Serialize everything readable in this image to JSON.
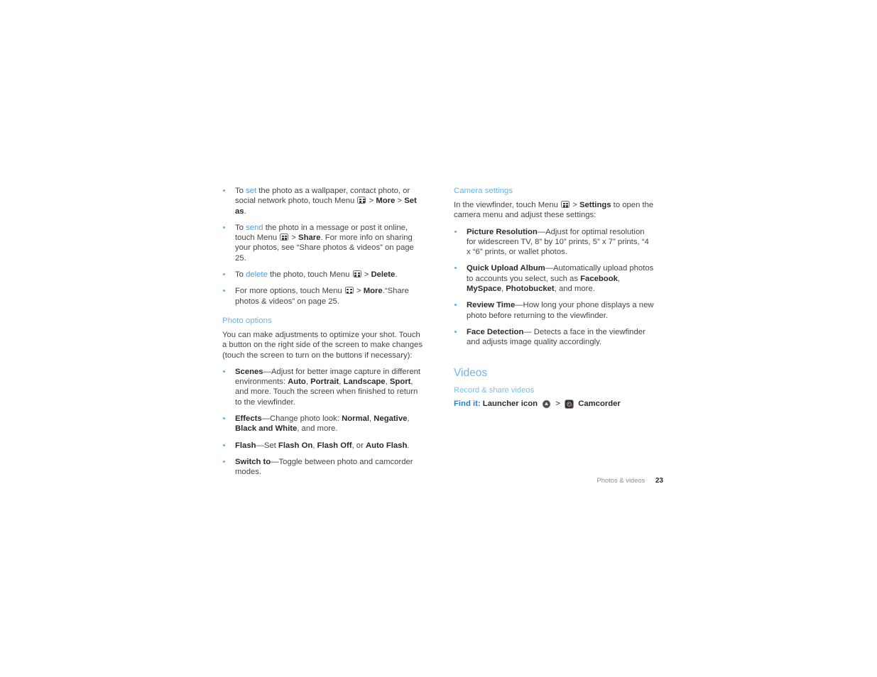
{
  "colors": {
    "heading_blue": "#69b3e7",
    "link_blue": "#4d9de0",
    "findit_blue": "#2a7fc9",
    "body_text": "#444444",
    "bold_text": "#2b2b2b",
    "footer_gray": "#8d8d8d",
    "bullet": "#6aa9e0"
  },
  "icons": {
    "menu_key": "menu-key-icon",
    "launcher": "launcher-icon",
    "camcorder": "camcorder-icon"
  },
  "left_column": {
    "photo_bullets": [
      {
        "parts": [
          {
            "t": "To ",
            "s": "n"
          },
          {
            "t": "set",
            "s": "link"
          },
          {
            "t": " the photo as a wallpaper, contact photo, or social network photo, touch Menu ",
            "s": "n"
          },
          {
            "t": "",
            "s": "menuicon"
          },
          {
            "t": " > ",
            "s": "n"
          },
          {
            "t": "More",
            "s": "b"
          },
          {
            "t": " > ",
            "s": "n"
          },
          {
            "t": "Set as",
            "s": "b"
          },
          {
            "t": ".",
            "s": "n"
          }
        ]
      },
      {
        "parts": [
          {
            "t": "To ",
            "s": "n"
          },
          {
            "t": "send",
            "s": "link"
          },
          {
            "t": " the photo in a message or post it online, touch Menu ",
            "s": "n"
          },
          {
            "t": "",
            "s": "menuicon"
          },
          {
            "t": " > ",
            "s": "n"
          },
          {
            "t": "Share",
            "s": "b"
          },
          {
            "t": ". For more info on sharing your photos, see “Share photos & videos” on page 25.",
            "s": "n"
          }
        ]
      },
      {
        "parts": [
          {
            "t": "To ",
            "s": "n"
          },
          {
            "t": "delete",
            "s": "link"
          },
          {
            "t": " the photo, touch Menu ",
            "s": "n"
          },
          {
            "t": "",
            "s": "menuicon"
          },
          {
            "t": " > ",
            "s": "n"
          },
          {
            "t": "Delete",
            "s": "b"
          },
          {
            "t": ".",
            "s": "n"
          }
        ]
      },
      {
        "parts": [
          {
            "t": "For more options, touch Menu ",
            "s": "n"
          },
          {
            "t": "",
            "s": "menuicon"
          },
          {
            "t": " > ",
            "s": "n"
          },
          {
            "t": "More",
            "s": "b"
          },
          {
            "t": ".“Share photos & videos” on page 25.",
            "s": "n"
          }
        ]
      }
    ],
    "photo_options_heading": "Photo options",
    "photo_options_intro": "You can make adjustments to optimize your shot. Touch a button on the right side of the screen to make changes (touch the screen to turn on the buttons if necessary):",
    "option_bullets": [
      {
        "parts": [
          {
            "t": "Scenes",
            "s": "b"
          },
          {
            "t": "—Adjust for better image capture in different environments: ",
            "s": "n"
          },
          {
            "t": "Auto",
            "s": "b"
          },
          {
            "t": ", ",
            "s": "n"
          },
          {
            "t": "Portrait",
            "s": "b"
          },
          {
            "t": ", ",
            "s": "n"
          },
          {
            "t": "Landscape",
            "s": "b"
          },
          {
            "t": ", ",
            "s": "n"
          },
          {
            "t": "Sport",
            "s": "b"
          },
          {
            "t": ", and more. Touch the screen when finished to return to the viewfinder.",
            "s": "n"
          }
        ]
      },
      {
        "parts": [
          {
            "t": "Effects",
            "s": "b"
          },
          {
            "t": "—Change photo look: ",
            "s": "n"
          },
          {
            "t": "Normal",
            "s": "b"
          },
          {
            "t": ", ",
            "s": "n"
          },
          {
            "t": "Negative",
            "s": "b"
          },
          {
            "t": ", ",
            "s": "n"
          },
          {
            "t": "Black and White",
            "s": "b"
          },
          {
            "t": ", and more.",
            "s": "n"
          }
        ]
      },
      {
        "parts": [
          {
            "t": "Flash",
            "s": "b"
          },
          {
            "t": "—Set ",
            "s": "n"
          },
          {
            "t": "Flash On",
            "s": "b"
          },
          {
            "t": ", ",
            "s": "n"
          },
          {
            "t": "Flash Off",
            "s": "b"
          },
          {
            "t": ", or ",
            "s": "n"
          },
          {
            "t": "Auto Flash",
            "s": "b"
          },
          {
            "t": ".",
            "s": "n"
          }
        ]
      },
      {
        "parts": [
          {
            "t": "Switch to",
            "s": "b"
          },
          {
            "t": "—Toggle between photo and camcorder modes.",
            "s": "n"
          }
        ]
      }
    ]
  },
  "right_column": {
    "camera_settings_heading": "Camera settings",
    "camera_settings_intro": [
      {
        "t": "In the viewfinder, touch Menu ",
        "s": "n"
      },
      {
        "t": "",
        "s": "menuicon"
      },
      {
        "t": " > ",
        "s": "n"
      },
      {
        "t": "Settings",
        "s": "b"
      },
      {
        "t": " to open the camera menu and adjust these settings:",
        "s": "n"
      }
    ],
    "setting_bullets": [
      {
        "parts": [
          {
            "t": "Picture Resolution",
            "s": "b"
          },
          {
            "t": "—Adjust for optimal resolution for widescreen TV, 8” by 10” prints, 5” x 7” prints, “4 x “6” prints, or wallet photos.",
            "s": "n"
          }
        ]
      },
      {
        "parts": [
          {
            "t": "Quick Upload Album",
            "s": "b"
          },
          {
            "t": "—Automatically upload photos to accounts you select, such as ",
            "s": "n"
          },
          {
            "t": "Facebook",
            "s": "b"
          },
          {
            "t": ", ",
            "s": "n"
          },
          {
            "t": "MySpace",
            "s": "b"
          },
          {
            "t": ", ",
            "s": "n"
          },
          {
            "t": "Photobucket",
            "s": "b"
          },
          {
            "t": ", and more.",
            "s": "n"
          }
        ]
      },
      {
        "parts": [
          {
            "t": " Review Time",
            "s": "b"
          },
          {
            "t": "—How long your phone displays a new photo before returning to the viewfinder.",
            "s": "n"
          }
        ]
      },
      {
        "parts": [
          {
            "t": " Face Detection",
            "s": "b"
          },
          {
            "t": "— Detects a face in the viewfinder and adjusts image quality accordingly.",
            "s": "n"
          }
        ]
      }
    ],
    "videos_heading": "Videos",
    "record_share_heading": "Record & share videos",
    "find_it": {
      "label": "Find it:",
      "step_1": "Launcher icon",
      "separator": ">",
      "step_2": "Camcorder"
    }
  },
  "footer": {
    "chapter": "Photos & videos",
    "page_number": "23"
  }
}
